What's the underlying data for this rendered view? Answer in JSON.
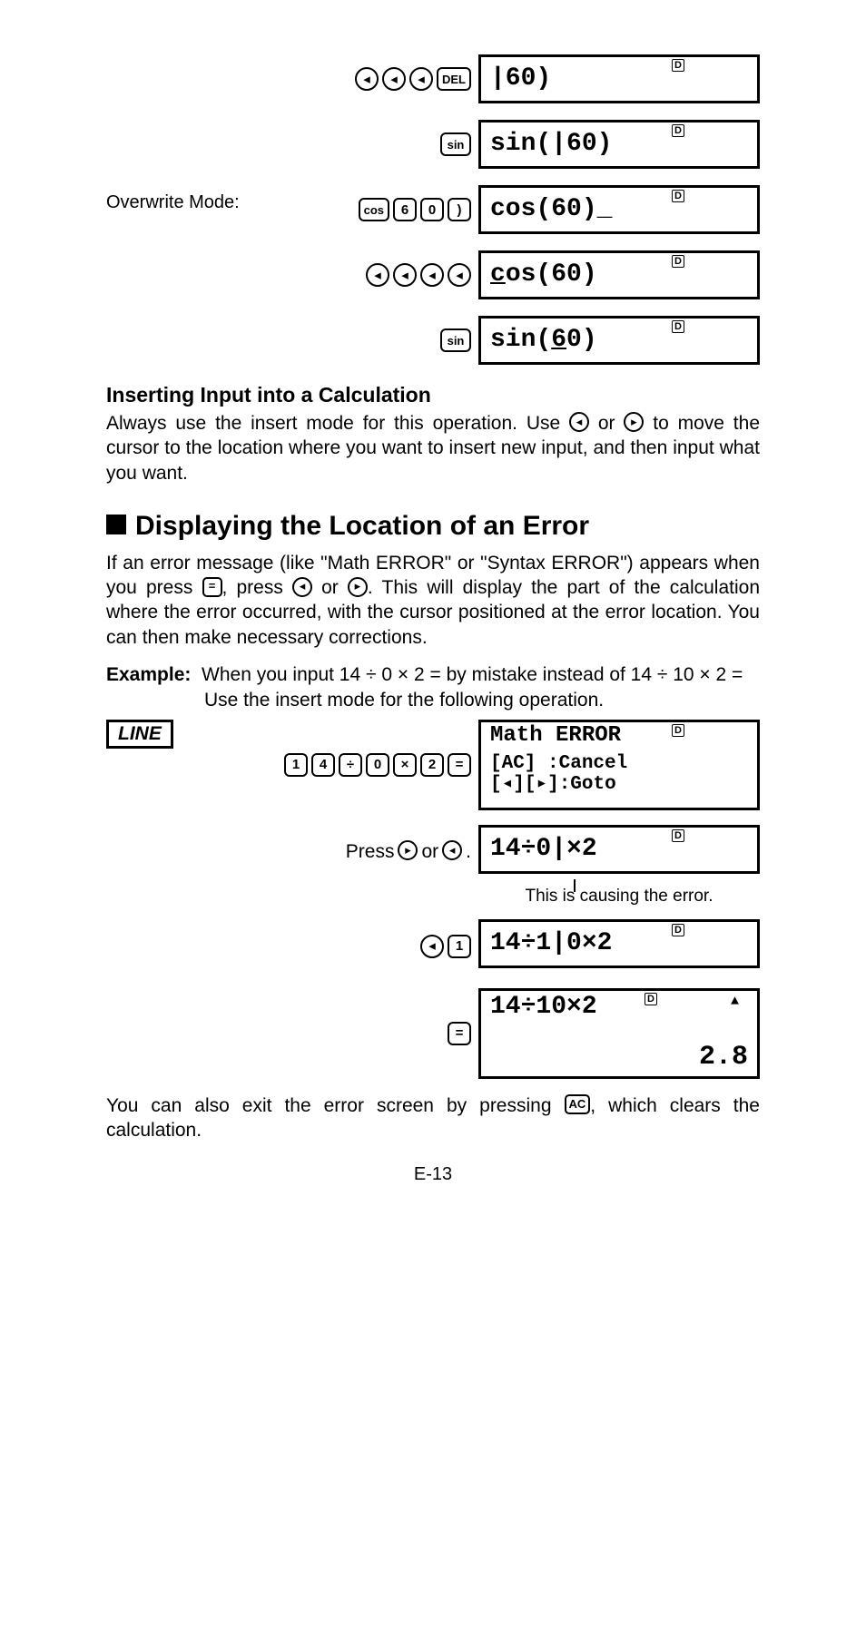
{
  "rows": [
    {
      "keys": [
        "◄",
        "◄",
        "◄",
        "DEL"
      ],
      "display": "|60)"
    },
    {
      "keys": [
        "sin"
      ],
      "display": "sin(|60)"
    },
    {
      "label": "Overwrite Mode:",
      "keys": [
        "cos",
        "6",
        "0",
        ")"
      ],
      "display": "cos(60)_"
    },
    {
      "keys": [
        "◄",
        "◄",
        "◄",
        "◄"
      ],
      "display": "cos(60)",
      "underline_c": true
    },
    {
      "keys": [
        "sin"
      ],
      "display": "sin(60)",
      "underline_6": true
    }
  ],
  "heading_insert": "Inserting Input into a Calculation",
  "para_insert_1": "Always use the insert mode for this operation. Use ",
  "para_insert_2": " or ",
  "para_insert_3": " to move the cursor to the location where you want to insert new input, and then input what you want.",
  "heading_error": "Displaying the Location of an Error",
  "para_error_1": "If an error message (like \"Math ERROR\" or \"Syntax ERROR\") appears when you press ",
  "para_error_2": ", press ",
  "para_error_3": " or ",
  "para_error_4": ". This will display the part of the calculation where the error occurred, with the cursor positioned at the error location. You can then make necessary corrections.",
  "example_label": "Example:",
  "example_1": "When you input 14 ÷ 0 × 2 = by mistake instead of 14 ÷ 10 × 2 =",
  "example_2": "Use the insert mode for the following operation.",
  "line_label": "LINE",
  "err_screen_l1": "Math ERROR",
  "err_screen_l2": "[AC]  :Cancel",
  "err_screen_l3": "[◂][▸]:Goto",
  "err_keys": [
    "1",
    "4",
    "÷",
    "0",
    "×",
    "2",
    "="
  ],
  "press_text_1": "Press ",
  "press_text_2": " or ",
  "press_text_3": ".",
  "step2_display": "14÷0|×2",
  "note_cause": "This is causing the error.",
  "step3_display": "14÷1|0×2",
  "step3_keys": [
    "◄",
    "1"
  ],
  "step4_display": "14÷10×2",
  "step4_result": "2.8",
  "step4_keys": [
    "="
  ],
  "para_exit_1": "You can also exit the error screen by pressing ",
  "para_exit_2": ", which clears the calculation.",
  "ac_label": "AC",
  "equals_label": "=",
  "d_indicator": "D",
  "page_number": "E-13"
}
